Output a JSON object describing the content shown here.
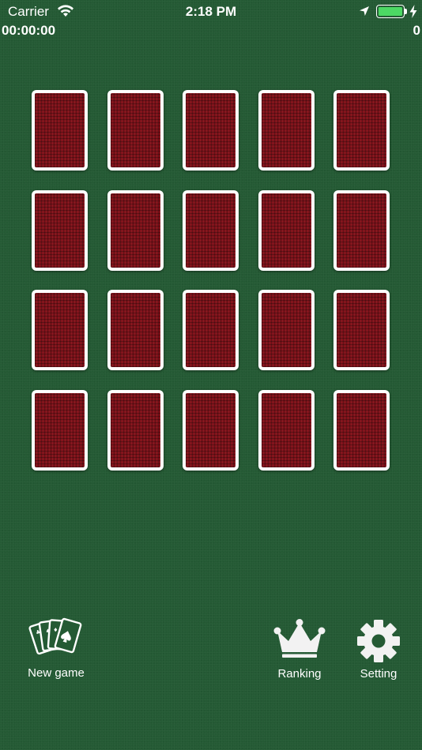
{
  "status_bar": {
    "carrier": "Carrier",
    "time": "2:18 PM",
    "battery_level": 1.0,
    "battery_color": "#4cd964",
    "icons": [
      "wifi-icon",
      "location-arrow-icon",
      "battery-icon",
      "charging-bolt-icon"
    ]
  },
  "game": {
    "timer": "00:00:00",
    "score": "0",
    "card_state": "face-down",
    "card_back_color": "#7d1018",
    "table_color": "#245a34",
    "rows": 4,
    "columns": 5
  },
  "toolbar": {
    "new_game": {
      "label": "New game",
      "icon": "playing-cards-icon"
    },
    "ranking": {
      "label": "Ranking",
      "icon": "crown-icon"
    },
    "setting": {
      "label": "Setting",
      "icon": "gear-icon"
    }
  }
}
